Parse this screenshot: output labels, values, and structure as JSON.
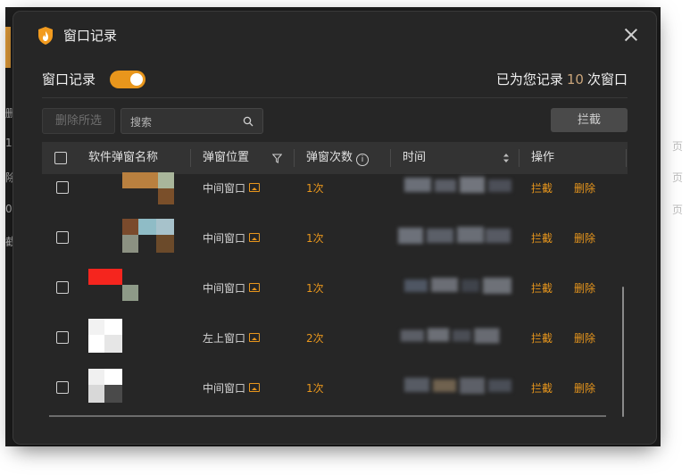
{
  "background": {
    "left_glyphs": [
      "删",
      "1",
      "除",
      "0",
      "截"
    ],
    "right_glyphs": [
      "页",
      "页",
      "页"
    ]
  },
  "dialog": {
    "title": "窗口记录",
    "logo_icon": "shield-flame-icon",
    "close_icon": "close-icon",
    "toggle": {
      "label": "窗口记录",
      "on": true,
      "color": "#e8961c"
    },
    "summary": {
      "prefix": "已为您记录",
      "count": "10",
      "suffix": "次窗口"
    },
    "toolbar": {
      "delete_selected_label": "删除所选",
      "search_placeholder": "搜索",
      "block_label": "拦截"
    },
    "table": {
      "headers": {
        "name": "软件弹窗名称",
        "position": "弹窗位置",
        "count": "弹窗次数",
        "count_info": "i",
        "time": "时间",
        "action": "操作"
      },
      "rows": [
        {
          "position": "中间窗口",
          "times": "1次",
          "block": "拦截",
          "delete": "删除"
        },
        {
          "position": "中间窗口",
          "times": "1次",
          "block": "拦截",
          "delete": "删除"
        },
        {
          "position": "中间窗口",
          "times": "1次",
          "block": "拦截",
          "delete": "删除"
        },
        {
          "position": "左上窗口",
          "times": "2次",
          "block": "拦截",
          "delete": "删除"
        },
        {
          "position": "中间窗口",
          "times": "1次",
          "block": "拦截",
          "delete": "删除"
        }
      ]
    }
  },
  "colors": {
    "accent": "#e8961c",
    "dialog_bg": "#262626",
    "header_bg": "#333333"
  }
}
